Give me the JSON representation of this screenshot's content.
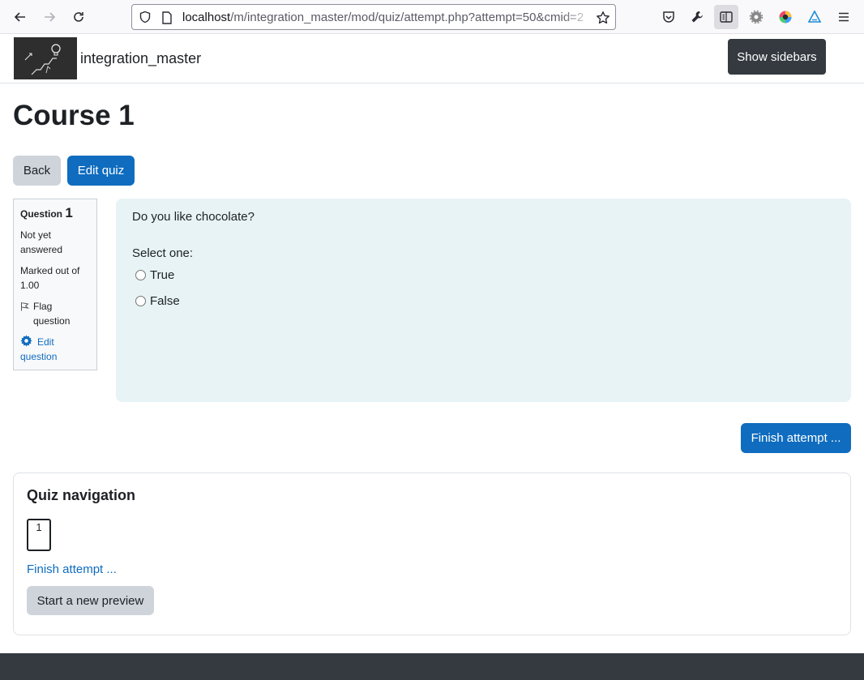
{
  "browser": {
    "url_host": "localhost",
    "url_path": "/m/integration_master/mod/quiz/attempt.php?attempt=50&cmid=2"
  },
  "header": {
    "site_name": "integration_master",
    "show_sidebars_label": "Show sidebars"
  },
  "page": {
    "course_title": "Course 1",
    "back_label": "Back",
    "edit_quiz_label": "Edit quiz"
  },
  "question_info": {
    "question_label": "Question",
    "question_number": "1",
    "state": "Not yet answered",
    "grade": "Marked out of 1.00",
    "flag_label": "Flag question",
    "edit_label": "Edit question"
  },
  "question": {
    "text": "Do you like chocolate?",
    "prompt": "Select one:",
    "options": [
      "True",
      "False"
    ]
  },
  "finish_attempt_label": "Finish attempt ...",
  "quiz_navigation": {
    "title": "Quiz navigation",
    "buttons": [
      "1"
    ],
    "finish_link": "Finish attempt ...",
    "new_preview_label": "Start a new preview"
  },
  "colors": {
    "primary": "#0f6cbf",
    "secondary": "#ced4da",
    "dark": "#343a40",
    "question_bg": "#e7f3f5"
  }
}
